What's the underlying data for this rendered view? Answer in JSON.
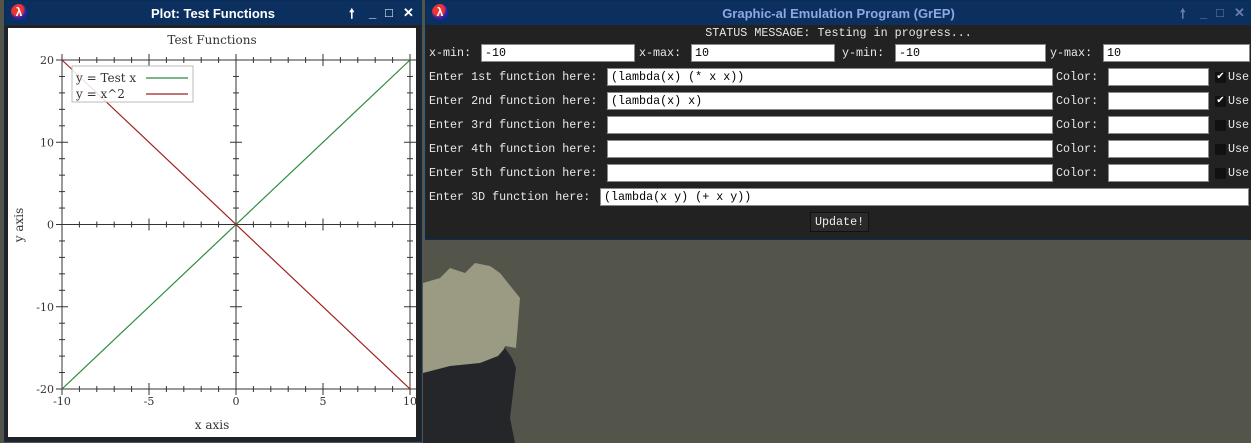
{
  "plot_window": {
    "title": "Plot: Test Functions",
    "buttons": {
      "keep_above": "🠕",
      "minimize": "_",
      "maximize": "□",
      "close": "✕"
    }
  },
  "chart_data": {
    "type": "line",
    "title": "Test Functions",
    "xlabel": "x axis",
    "ylabel": "y axis",
    "xlim": [
      -10,
      10
    ],
    "ylim": [
      -20,
      20
    ],
    "xticks": [
      -10,
      -5,
      0,
      5,
      10
    ],
    "yticks": [
      -20,
      -10,
      0,
      10,
      20
    ],
    "legend_position": "top-left",
    "series": [
      {
        "name": "y = Test x",
        "color": "#2e8b40",
        "x": [
          -10,
          10
        ],
        "y": [
          -20,
          20
        ]
      },
      {
        "name": "y = x^2",
        "color": "#a02020",
        "x": [
          -10,
          10
        ],
        "y": [
          20,
          -20
        ]
      }
    ]
  },
  "grep_window": {
    "title": "Graphic-al Emulation Program (GrEP)",
    "status": "STATUS MESSAGE: Testing in progress...",
    "ranges": [
      {
        "label": "x-min:",
        "value": "-10"
      },
      {
        "label": "x-max:",
        "value": "10"
      },
      {
        "label": "y-min:",
        "value": "-10"
      },
      {
        "label": "y-max:",
        "value": "10"
      }
    ],
    "functions": [
      {
        "label": "Enter 1st function here:",
        "value": "(lambda(x) (* x x))",
        "color_label": "Color:",
        "color_value": "",
        "use_label": "Use",
        "use": true
      },
      {
        "label": "Enter 2nd function here:",
        "value": "(lambda(x) x)",
        "color_label": "Color:",
        "color_value": "",
        "use_label": "Use",
        "use": true
      },
      {
        "label": "Enter 3rd function here:",
        "value": "",
        "color_label": "Color:",
        "color_value": "",
        "use_label": "Use",
        "use": false
      },
      {
        "label": "Enter 4th function here:",
        "value": "",
        "color_label": "Color:",
        "color_value": "",
        "use_label": "Use",
        "use": false
      },
      {
        "label": "Enter 5th function here:",
        "value": "",
        "color_label": "Color:",
        "color_value": "",
        "use_label": "Use",
        "use": false
      }
    ],
    "function_3d": {
      "label": "Enter 3D function here:",
      "value": "(lambda(x y) (+ x y))"
    },
    "update_label": "Update!"
  }
}
